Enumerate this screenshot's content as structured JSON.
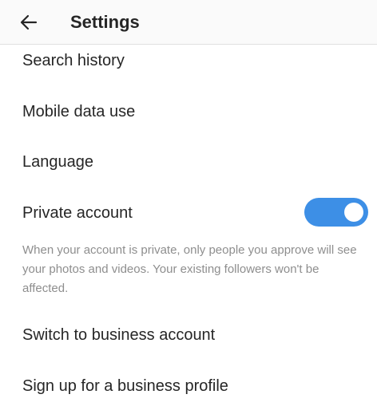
{
  "header": {
    "title": "Settings",
    "back_icon": "arrow-left-icon"
  },
  "settings": {
    "search_history": "Search history",
    "mobile_data_use": "Mobile data use",
    "language": "Language",
    "private_account": "Private account",
    "private_account_enabled": true,
    "private_account_description": "When your account is private, only people you approve will see your photos and videos. Your existing followers won't be affected.",
    "switch_business": "Switch to business account",
    "signup_business": "Sign up for a business profile"
  },
  "colors": {
    "toggle_on": "#3d8fe6",
    "text_primary": "#262626",
    "text_secondary": "#8e8e8e"
  }
}
